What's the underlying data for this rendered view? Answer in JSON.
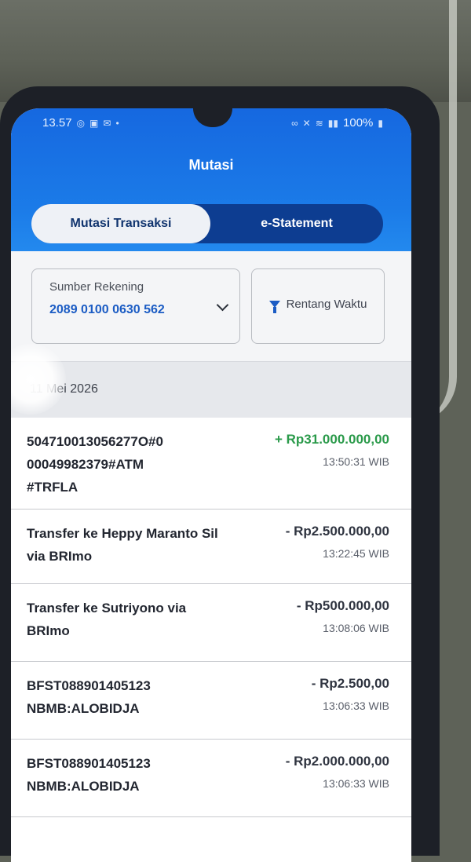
{
  "status_bar": {
    "time": "13.57",
    "battery": "100%"
  },
  "header": {
    "title": "Mutasi"
  },
  "tabs": [
    {
      "label": "Mutasi Transaksi",
      "active": true
    },
    {
      "label": "e-Statement",
      "active": false
    }
  ],
  "filters": {
    "account_label": "Sumber Rekening",
    "account_number": "2089 0100 0630 562",
    "range_label": "Rentang Waktu"
  },
  "date_header": "11 Mei 2026",
  "transactions": [
    {
      "description": "504710013056277O#0\n00049982379#ATM\n#TRFLA",
      "amount": "+ Rp31.000.000,00",
      "time": "13:50:31 WIB",
      "type": "credit"
    },
    {
      "description": "Transfer ke Heppy Maranto Sil\nvia BRImo",
      "amount": "- Rp2.500.000,00",
      "time": "13:22:45 WIB",
      "type": "debit"
    },
    {
      "description": "Transfer ke Sutriyono via\nBRImo",
      "amount": "- Rp500.000,00",
      "time": "13:08:06 WIB",
      "type": "debit"
    },
    {
      "description": "BFST088901405123\nNBMB:ALOBIDJA",
      "amount": "- Rp2.500,00",
      "time": "13:06:33 WIB",
      "type": "debit"
    },
    {
      "description": "BFST088901405123\nNBMB:ALOBIDJA",
      "amount": "- Rp2.000.000,00",
      "time": "13:06:33 WIB",
      "type": "debit"
    }
  ],
  "colors": {
    "header_blue": "#1b7be8",
    "credit_green": "#2a9a4a",
    "account_blue": "#1b5cc4"
  }
}
